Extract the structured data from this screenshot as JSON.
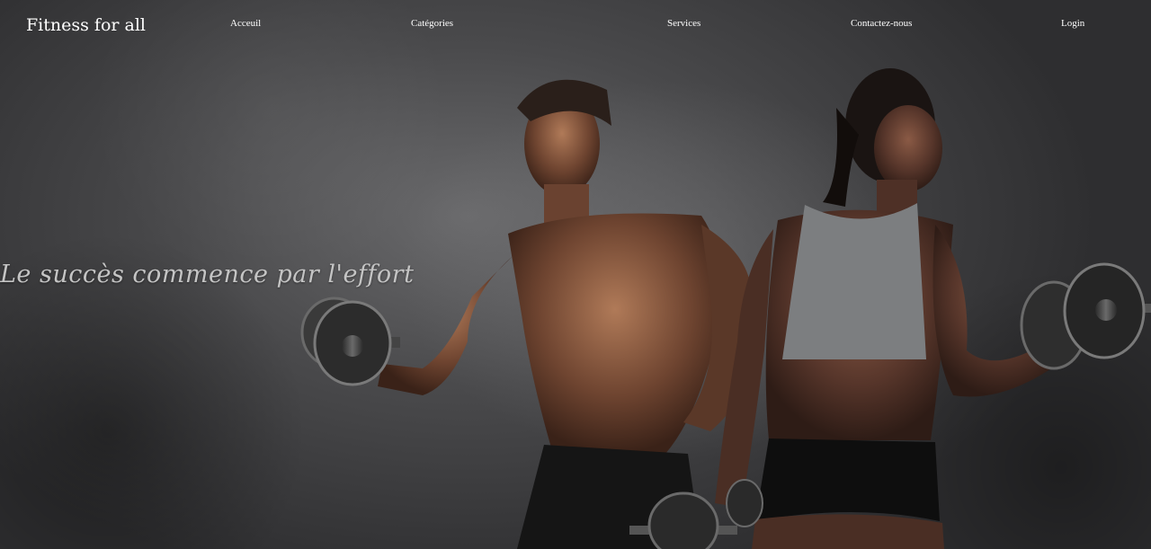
{
  "brand": {
    "name": "Fitness for all"
  },
  "nav": {
    "items": [
      {
        "label": "Acceuil"
      },
      {
        "label": "Catégories"
      },
      {
        "label": "Services"
      },
      {
        "label": "Contactez-nous"
      },
      {
        "label": "Login"
      }
    ]
  },
  "hero": {
    "tagline": "Le succès commence par l'effort"
  },
  "colors": {
    "nav_text": "#ffffff",
    "tagline": "#c4c4c4",
    "background": "#4a4a4c"
  }
}
